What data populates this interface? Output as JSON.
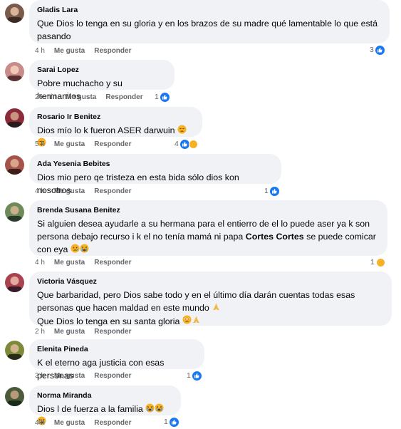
{
  "comments": [
    {
      "name": "Gladis Lara",
      "lines": [
        "Que Dios lo tenga en su gloria y en los brazos de su madre qué lamentable lo que está",
        "pasando"
      ],
      "time": "4 h",
      "like": "Me gusta",
      "reply": "Responder",
      "count": "3",
      "avatar_color": "#7a5a4a"
    },
    {
      "name": "Sarai Lopez",
      "lines": [
        "Pobre muchacho y su hermanitos"
      ],
      "time": "26 min",
      "like": "Me gusta",
      "reply": "Responder",
      "count": "1",
      "avatar_color": "#c98a8a"
    },
    {
      "name": "Rosario Ir Benitez",
      "lines": [
        "Dios mío lo k fueron ASER darwuin"
      ],
      "time": "5 h",
      "like": "Me gusta",
      "reply": "Responder",
      "count": "4",
      "avatar_color": "#8c2a3a"
    },
    {
      "name": "Ada Yesenia Bebites",
      "lines": [
        "Dios mio pero qe tristeza en esta bida sólo dios kon nosotros"
      ],
      "time": "4 h",
      "like": "Me gusta",
      "reply": "Responder",
      "count": "1",
      "avatar_color": "#a5524a"
    },
    {
      "name": "Brenda Susana Benitez",
      "lines": [
        "Si alguien desea ayudarle a su hermana para el entierro de el lo puede aser ya k son",
        "persona debajo recurso i k el no tenía mamá ni papa ",
        "con eya"
      ],
      "mention": "Cortes Cortes",
      "line2_tail": " se puede comicar",
      "time": "4 h",
      "like": "Me gusta",
      "reply": "Responder",
      "count": "1",
      "avatar_color": "#6f8a5a"
    },
    {
      "name": "Victoria Vásquez",
      "lines": [
        "Que barbaridad, pero Dios sabe todo y en el último día darán cuentas todas esas",
        "personas que hacen maldad en este mundo ",
        "Que Dios lo tenga en su santa gloria "
      ],
      "time": "2 h",
      "like": "Me gusta",
      "reply": "Responder",
      "count": "",
      "avatar_color": "#a8444f"
    },
    {
      "name": "Elenita Pineda",
      "lines": [
        "K el eterno aga justicia con esas personas"
      ],
      "time": "3 h",
      "like": "Me gusta",
      "reply": "Responder",
      "count": "1",
      "avatar_color": "#7d8a3a"
    },
    {
      "name": "Norma Miranda",
      "lines": [
        "Dios l de fuerza a la familia "
      ],
      "time": "4 h",
      "like": "Me gusta",
      "reply": "Responder",
      "count": "1",
      "avatar_color": "#4a5a3a"
    }
  ],
  "colors": {
    "like_blue": "#1877f2",
    "sad_yellow": "#f7b125",
    "bubble": "#f0f2f5",
    "meta": "#65676b"
  }
}
